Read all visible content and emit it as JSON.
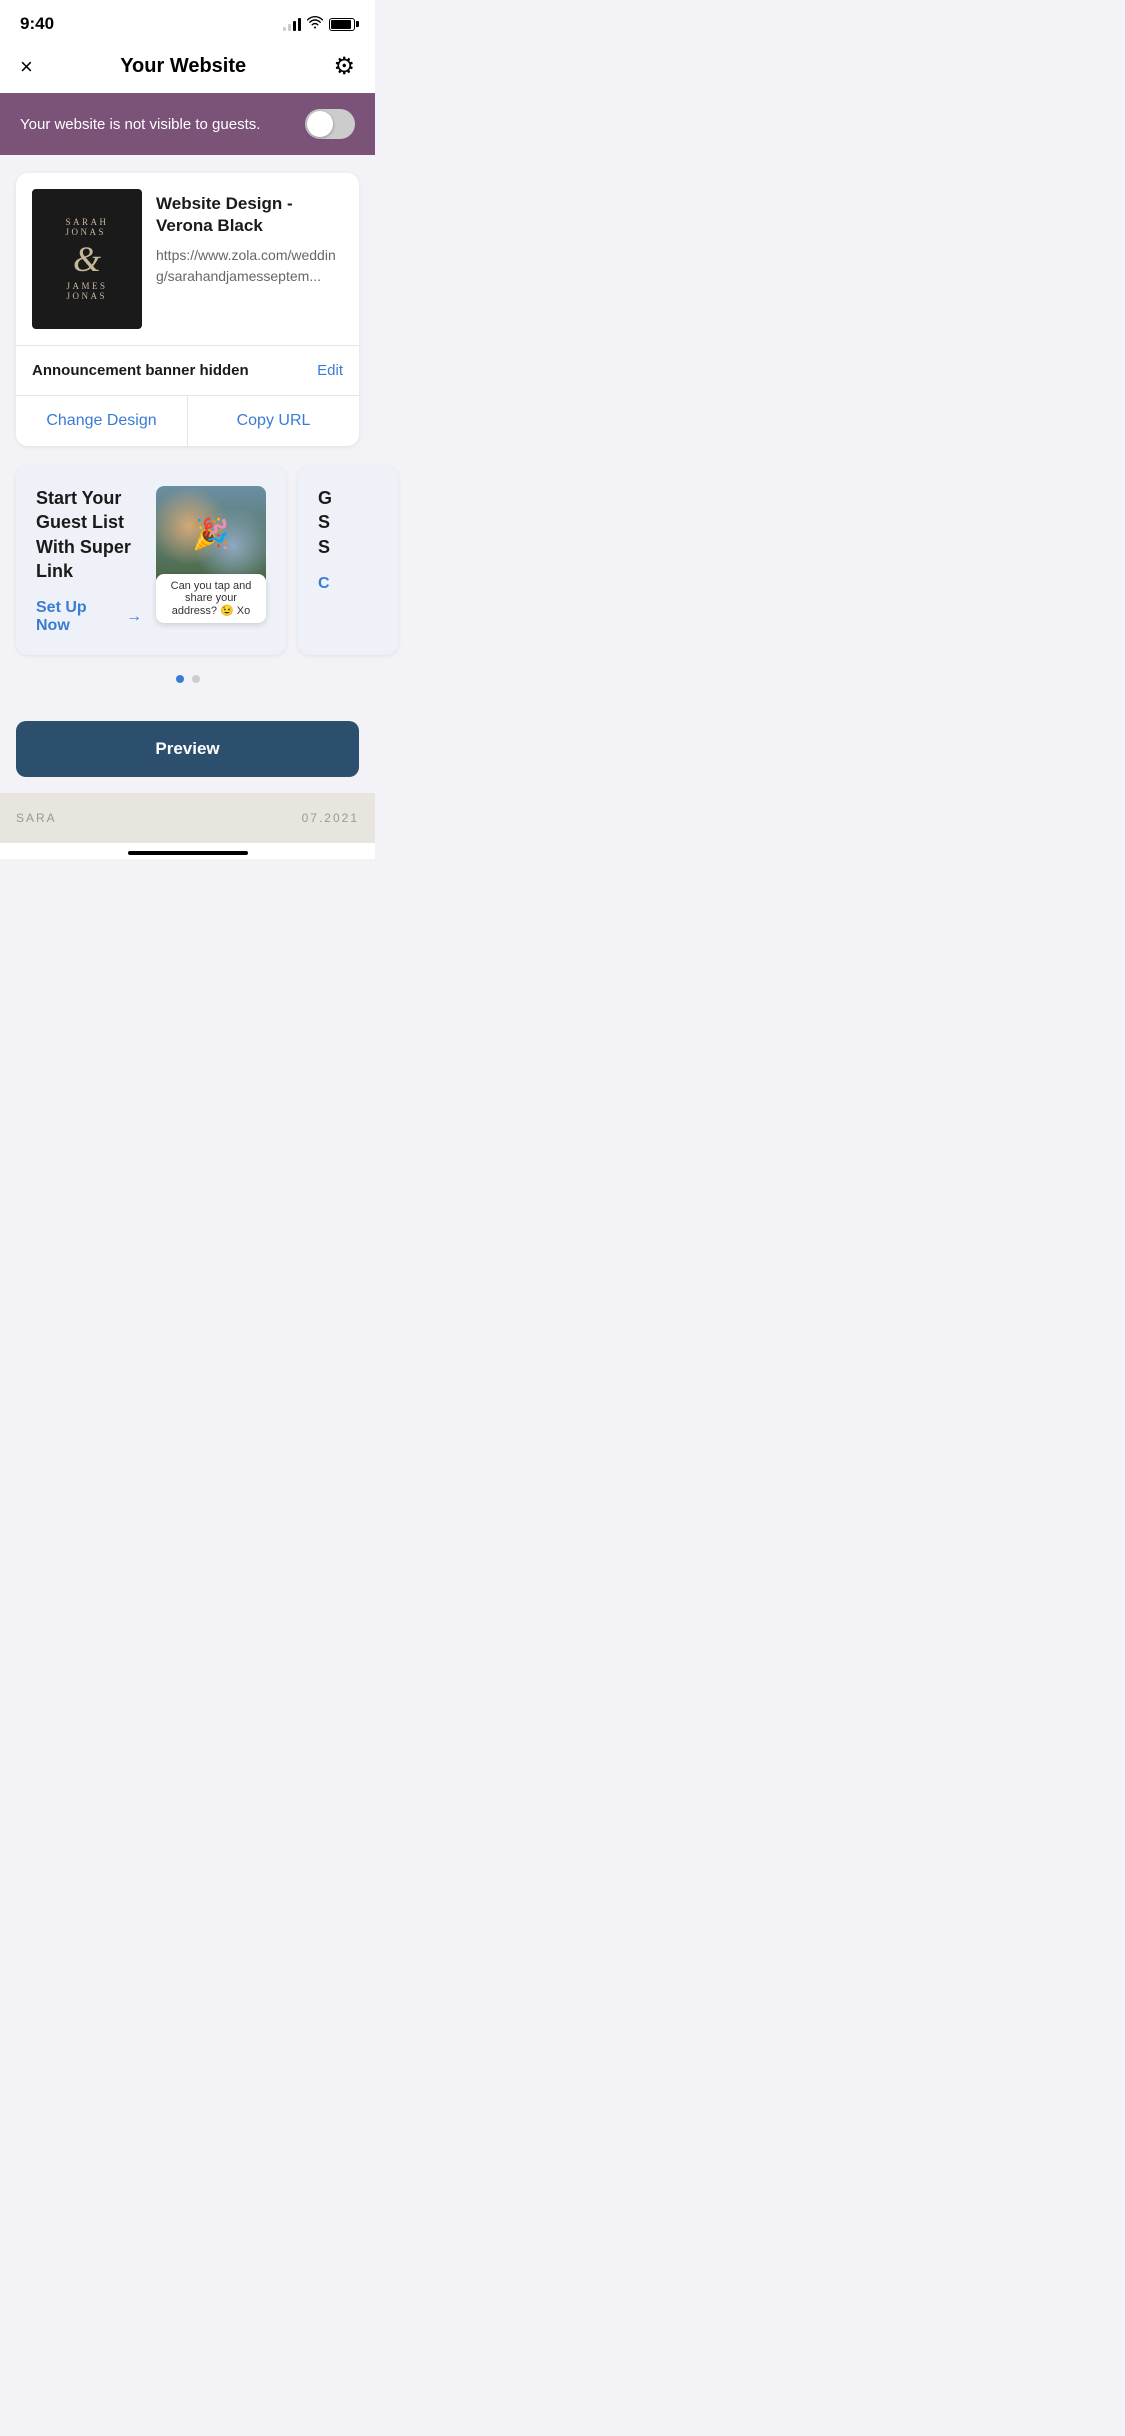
{
  "statusBar": {
    "time": "9:40",
    "signalBars": [
      2,
      3,
      4,
      4
    ],
    "wifiSymbol": "wifi"
  },
  "header": {
    "title": "Your Website",
    "closeLabel": "×",
    "gearLabel": "⚙"
  },
  "visibilityBanner": {
    "message": "Your website is not visible to guests.",
    "toggleState": "off"
  },
  "websiteCard": {
    "designName": "Website Design - Verona Black",
    "url": "https://www.zola.com/wedding/sarahandjamesseptem...",
    "thumbnailNames": {
      "top": "SARAH\nJONAS",
      "ampersand": "&",
      "bottom": "JAMES\nJONAS"
    },
    "announcementLabel": "Announcement banner hidden",
    "editLabel": "Edit",
    "changeDesignLabel": "Change Design",
    "copyUrlLabel": "Copy URL"
  },
  "promoCard": {
    "title": "Start Your Guest List With Super Link",
    "actionLabel": "Set Up Now",
    "actionArrow": "→",
    "imageCaption": "Can you tap and share your address? 😉 Xo"
  },
  "promoCard2": {
    "titleLetter": "G",
    "actionLabel": "C"
  },
  "dots": {
    "active": 0,
    "total": 2
  },
  "previewButton": {
    "label": "Preview"
  },
  "bottomStrip": {
    "leftText": "SARA",
    "rightText": "07.2021"
  }
}
